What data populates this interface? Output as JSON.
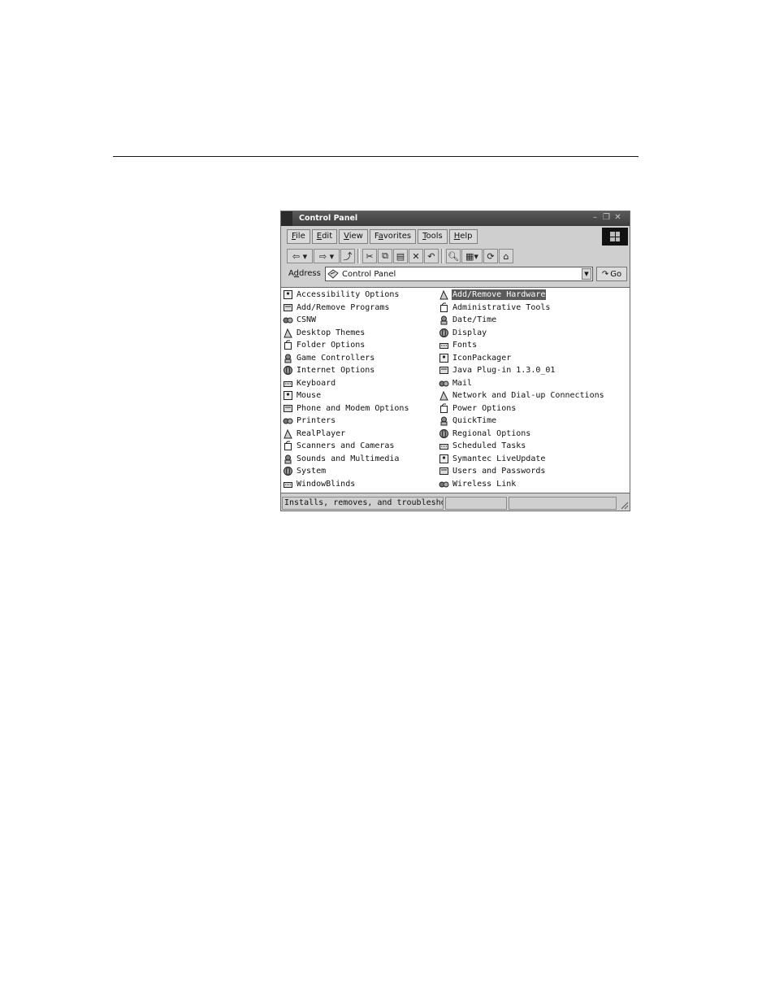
{
  "window": {
    "title": "Control Panel"
  },
  "menu": [
    {
      "pre": "",
      "key": "F",
      "post": "ile"
    },
    {
      "pre": "",
      "key": "E",
      "post": "dit"
    },
    {
      "pre": "",
      "key": "V",
      "post": "iew"
    },
    {
      "pre": "F",
      "key": "a",
      "post": "vorites"
    },
    {
      "pre": "",
      "key": "T",
      "post": "ools"
    },
    {
      "pre": "",
      "key": "H",
      "post": "elp"
    }
  ],
  "address": {
    "label_pre": "A",
    "label_key": "d",
    "label_post": "dress",
    "value": "Control Panel",
    "go_label": "Go"
  },
  "items_left": [
    "Accessibility Options",
    "Add/Remove Programs",
    "CSNW",
    "Desktop Themes",
    "Folder Options",
    "Game Controllers",
    "Internet Options",
    "Keyboard",
    "Mouse",
    "Phone and Modem Options",
    "Printers",
    "RealPlayer",
    "Scanners and Cameras",
    "Sounds and Multimedia",
    "System",
    "WindowBlinds"
  ],
  "items_right": [
    "Add/Remove Hardware",
    "Administrative Tools",
    "Date/Time",
    "Display",
    "Fonts",
    "IconPackager",
    "Java Plug-in 1.3.0_01",
    "Mail",
    "Network and Dial-up Connections",
    "Power Options",
    "QuickTime",
    "Regional Options",
    "Scheduled Tasks",
    "Symantec LiveUpdate",
    "Users and Passwords",
    "Wireless Link"
  ],
  "selected_item": "Add/Remove Hardware",
  "status": {
    "text": "Installs, removes, and troubleshoots h"
  }
}
